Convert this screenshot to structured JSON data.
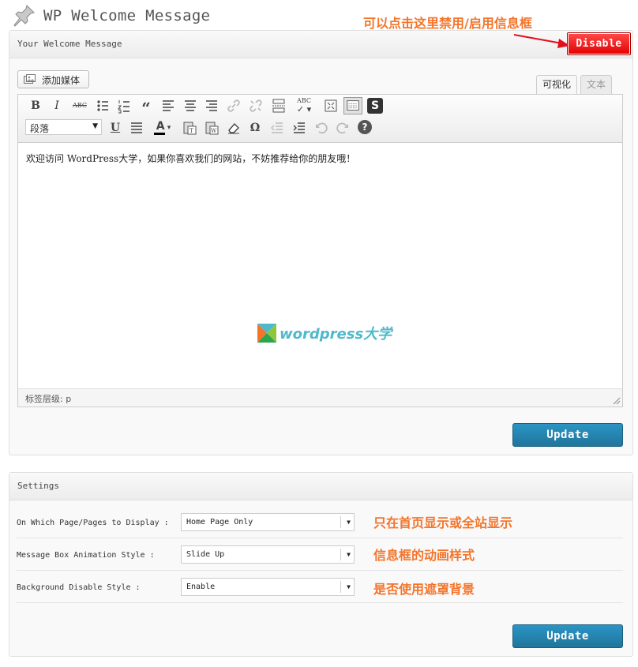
{
  "page": {
    "title": "WP Welcome Message",
    "annotation_top": "可以点击这里禁用/启用信息框"
  },
  "message_box": {
    "heading": "Your Welcome Message",
    "disable_label": "Disable",
    "add_media_label": "添加媒体",
    "tabs": {
      "visual": "可视化",
      "text": "文本"
    },
    "format_select_value": "段落",
    "content": "欢迎访问 WordPress大学，如果你喜欢我们的网站，不妨推荐给你的朋友哦！",
    "watermark": "wordpress大学",
    "status_path": "标签层级: p",
    "update_label": "Update"
  },
  "toolbar_icons": {
    "row1": [
      "bold-icon",
      "italic-icon",
      "strikethrough-icon",
      "bullet-list-icon",
      "numbered-list-icon",
      "blockquote-icon",
      "align-left-icon",
      "align-center-icon",
      "align-right-icon",
      "link-icon",
      "unlink-icon",
      "read-more-icon",
      "spellcheck-icon",
      "fullscreen-icon",
      "kitchen-sink-icon",
      "shortcode-icon"
    ],
    "row2": [
      "format-select",
      "underline-icon",
      "justify-icon",
      "text-color-icon",
      "paste-text-icon",
      "paste-word-icon",
      "clear-format-icon",
      "special-character-icon",
      "outdent-icon",
      "indent-icon",
      "undo-icon",
      "redo-icon",
      "help-icon"
    ]
  },
  "settings": {
    "heading": "Settings",
    "rows": [
      {
        "label": "On Which Page/Pages to Display :",
        "value": "Home Page Only",
        "annotation": "只在首页显示或全站显示"
      },
      {
        "label": "Message Box Animation Style :",
        "value": "Slide Up",
        "annotation": "信息框的动画样式"
      },
      {
        "label": "Background Disable Style :",
        "value": "Enable",
        "annotation": "是否使用遮罩背景"
      }
    ],
    "update_label": "Update"
  },
  "colors": {
    "annotation": "#f4742a",
    "disable_button": "#e20000",
    "update_button": "#21759b",
    "watermark": "#4fb9cb"
  }
}
